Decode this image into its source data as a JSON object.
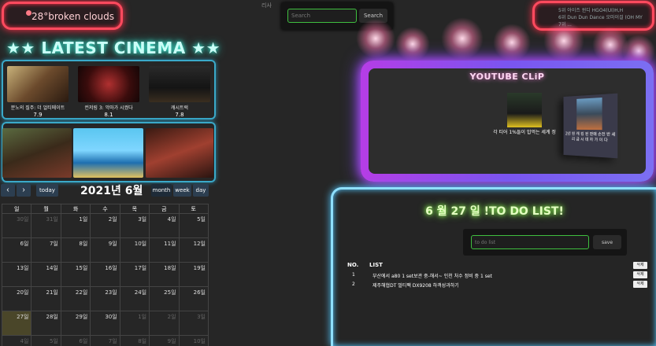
{
  "weather": {
    "text": "28°broken clouds"
  },
  "search": {
    "broken_image_alt": "리사",
    "placeholder": "Search",
    "button": "Search"
  },
  "music": {
    "lines": [
      "5위 아이즈 윈디 HGO4(UI)H,H",
      "6위 Dun Dun Dance 오마이걸 (OH MY",
      "7위 ..."
    ]
  },
  "cinema": {
    "title": "★★ LATEST CINEMA ★★",
    "row1": [
      {
        "title": "분노의 질주: 더 얼티메이트",
        "rating": "7.9"
      },
      {
        "title": "컨저링 3: 악마가 시켰다",
        "rating": "8.1"
      },
      {
        "title": "캐시트럭",
        "rating": "7.8"
      }
    ],
    "row2_icons": [
      "poster-thumb",
      "poster-thumb",
      "poster-thumb"
    ]
  },
  "calendar": {
    "prev": "‹",
    "next": "›",
    "today": "today",
    "title": "2021년 6월",
    "views": [
      "month",
      "week",
      "day"
    ],
    "weekdays": [
      "일",
      "월",
      "화",
      "수",
      "목",
      "금",
      "토"
    ],
    "weeks": [
      [
        "30일",
        "31일",
        "1일",
        "2일",
        "3일",
        "4일",
        "5일"
      ],
      [
        "6일",
        "7일",
        "8일",
        "9일",
        "10일",
        "11일",
        "12일"
      ],
      [
        "13일",
        "14일",
        "15일",
        "16일",
        "17일",
        "18일",
        "19일"
      ],
      [
        "20일",
        "21일",
        "22일",
        "23일",
        "24일",
        "25일",
        "26일"
      ],
      [
        "27일",
        "28일",
        "29일",
        "30일",
        "1일",
        "2일",
        "3일"
      ],
      [
        "4일",
        "5일",
        "6일",
        "7일",
        "8일",
        "9일",
        "10일"
      ]
    ]
  },
  "youtube": {
    "title": "YOUTUBE CLiP",
    "videos": [
      {
        "title": "각 티어 1%들이 밥먹는 세계 정"
      },
      {
        "title": "2년 된 캐 킹 된 판매 손전 반 세리 금 시 데 자 가 이 다"
      }
    ]
  },
  "todo": {
    "title": "6 월 27 일 !TO DO LIST!",
    "placeholder": "to do list",
    "save": "save",
    "col_num": "NO.",
    "col_list": "LIST",
    "delete_label": "삭제",
    "items": [
      {
        "no": "1",
        "text": "부산에서 a80 1 set보관 중-해서~ 인천 처수 정비 중 1 set"
      },
      {
        "no": "2",
        "text": "제주해협DT 멀티팩 DX9208 하객성과하기"
      }
    ]
  },
  "colors": {
    "neon_red": "#ff4a5e",
    "neon_cyan": "#3ef0d8",
    "neon_purple": "#b53de6",
    "neon_blue": "#8fe0ff",
    "neon_green": "#9aff5c"
  }
}
